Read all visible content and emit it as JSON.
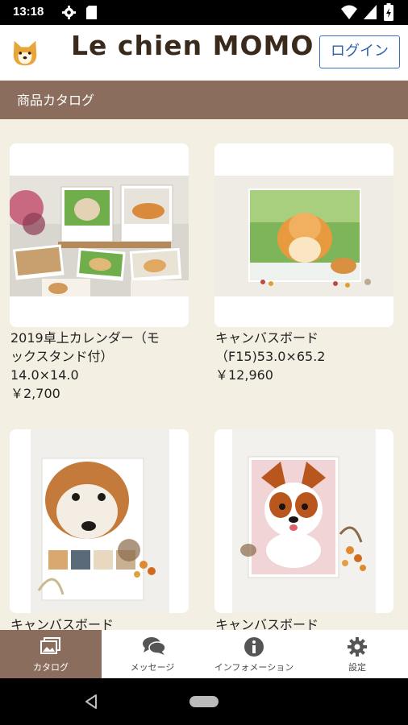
{
  "status_bar": {
    "time": "13:18"
  },
  "header": {
    "brand": "Le chien MOMO",
    "login_label": "ログイン"
  },
  "subheader": {
    "title": "商品カタログ"
  },
  "products": [
    {
      "name_line1": "2019卓上カレンダー（モ",
      "name_line2": "ックスタンド付）",
      "size": "14.0×14.0",
      "price": "￥2,700"
    },
    {
      "name_line1": "キャンバスボード",
      "name_line2": "（F15)53.0×65.2",
      "size": "",
      "price": "￥12,960"
    },
    {
      "name_line1": "キャンバスボード",
      "name_line2": "",
      "size": "",
      "price": ""
    },
    {
      "name_line1": "キャンバスボード",
      "name_line2": "",
      "size": "",
      "price": ""
    }
  ],
  "tabs": [
    {
      "label": "カタログ",
      "icon": "catalog-icon"
    },
    {
      "label": "メッセージ",
      "icon": "message-icon"
    },
    {
      "label": "インフォメーション",
      "icon": "info-icon"
    },
    {
      "label": "設定",
      "icon": "gear-icon"
    }
  ],
  "colors": {
    "header_brown": "#8b6d5e",
    "background": "#f4efe3",
    "login_blue": "#2e62b0"
  }
}
